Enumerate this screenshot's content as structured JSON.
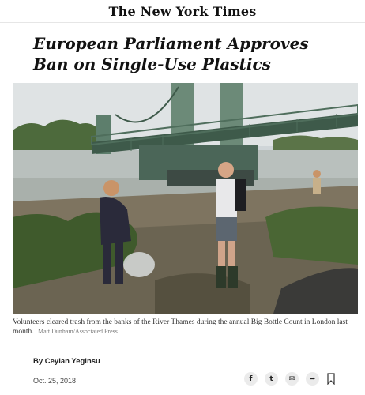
{
  "masthead": {
    "logo_text": "The New York Times"
  },
  "article": {
    "headline_line1": "European Parliament Approves",
    "headline_line2": "Ban on Single-Use Plastics",
    "photo": {
      "subject": "Volunteers clearing trash on the River Thames bank near a green iron bridge"
    },
    "caption": "Volunteers cleared trash from the banks of the River Thames during the annual Big Bottle Count in London last month.",
    "photo_credit": "Matt Dunham/Associated Press",
    "byline": "By Ceylan Yeginsu",
    "date": "Oct. 25, 2018"
  },
  "share": {
    "icons": [
      "facebook-icon",
      "twitter-icon",
      "email-icon",
      "share-arrow-icon",
      "bookmark-icon"
    ],
    "facebook_glyph": "f",
    "twitter_glyph": "t",
    "email_glyph": "✉",
    "share_glyph": "➦"
  }
}
